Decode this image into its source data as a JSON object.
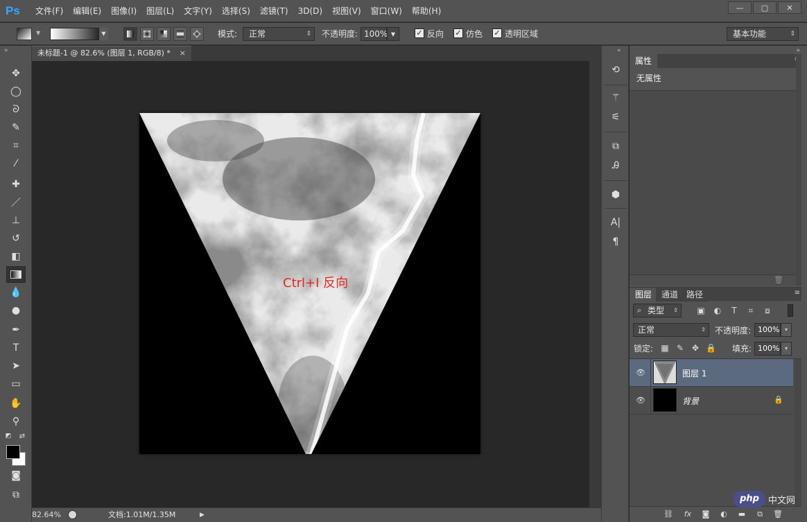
{
  "app": {
    "logo": "Ps"
  },
  "menu": [
    "文件(F)",
    "编辑(E)",
    "图像(I)",
    "图层(L)",
    "文字(Y)",
    "选择(S)",
    "滤镜(T)",
    "3D(D)",
    "视图(V)",
    "窗口(W)",
    "帮助(H)"
  ],
  "window_buttons": {
    "minimize": "—",
    "restore": "▢",
    "close": "✕"
  },
  "options": {
    "mode_label": "模式:",
    "mode_value": "正常",
    "opacity_label": "不透明度:",
    "opacity_value": "100%",
    "reverse_label": "反向",
    "dither_label": "仿色",
    "transparency_label": "透明区域",
    "workspace_value": "基本功能",
    "checked": [
      true,
      true,
      true
    ]
  },
  "document": {
    "tab_title": "未标题-1 @ 82.6% (图层 1, RGB/8) *",
    "annotation": "Ctrl+I 反向"
  },
  "status": {
    "zoom": "82.64%",
    "doc_info": "文档:1.01M/1.35M"
  },
  "properties": {
    "tab": "属性",
    "body": "无属性"
  },
  "layers_panel": {
    "tabs": [
      "图层",
      "通道",
      "路径"
    ],
    "filter_value": "类型",
    "blend_value": "正常",
    "opacity_label": "不透明度:",
    "opacity_value": "100%",
    "lock_label": "锁定:",
    "fill_label": "填充:",
    "fill_value": "100%",
    "layers": [
      {
        "name": "图层 1",
        "selected": true,
        "locked": false
      },
      {
        "name": "背景",
        "selected": false,
        "locked": true
      }
    ]
  },
  "watermark": {
    "badge": "php",
    "text": "中文网"
  },
  "colors": {
    "ui_dark": "#535353",
    "canvas_bg": "#282828",
    "selected_layer": "#5c6a80",
    "annotation": "#e8251f",
    "ps_blue": "#31a8ff"
  }
}
